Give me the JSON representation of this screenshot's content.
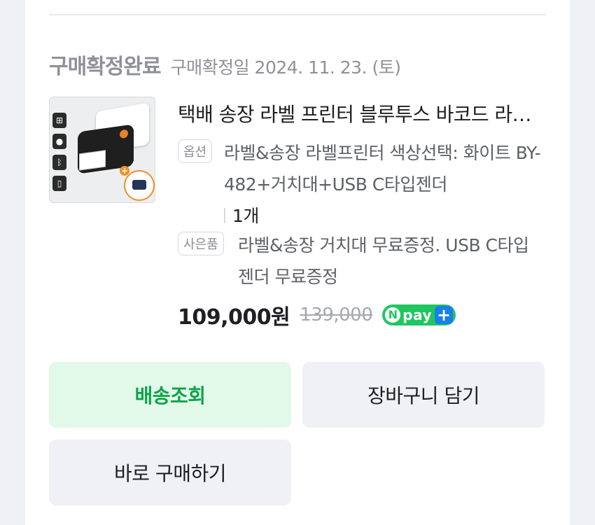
{
  "order": {
    "status": "구매확정완료",
    "confirm_date": "구매확정일 2024. 11. 23. (토)"
  },
  "product": {
    "title": "택배 송장 라벨 프린터 블루투스 바코드 라벨기",
    "option_tag": "옵션",
    "option_text": "라벨&송장 라벨프린터 색상선택: 화이트 BY-482+거치대+USB C타입젠더",
    "quantity": "1개",
    "gift_tag": "사은품",
    "gift_text": "라벨&송장 거치대 무료증정. USB C타입 젠더 무료증정",
    "price": "109,000원",
    "original_price": "139,000",
    "npay": {
      "n": "N",
      "pay": "pay",
      "plus": "+"
    },
    "thumbnail_icons": [
      "windows-icon",
      "apple-icon",
      "bluetooth-icon",
      "phone-icon"
    ]
  },
  "buttons": {
    "track": "배송조회",
    "cart": "장바구니 담기",
    "buy_now": "바로 구매하기"
  },
  "colors": {
    "accent_green": "#10a24b",
    "track_bg": "#e2f9ea",
    "npay_green": "#1ec760",
    "npay_blue": "#1a7fe6"
  }
}
